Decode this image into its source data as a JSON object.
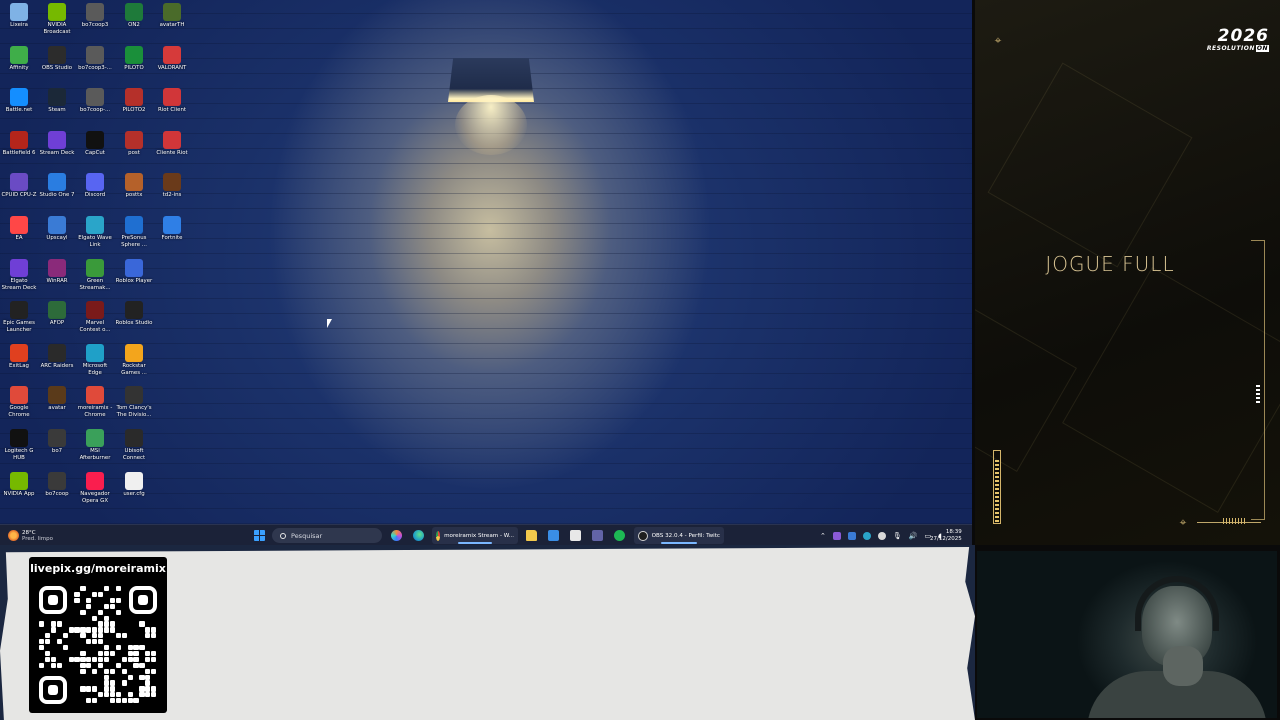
{
  "desktop": {
    "icons": [
      {
        "label": "Lixeira",
        "icon": "recycle-bin-icon",
        "color": "#7fb2e5"
      },
      {
        "label": "NVIDIA Broadcast",
        "icon": "nvidia-icon",
        "color": "#76b900"
      },
      {
        "label": "bo7coop3",
        "icon": "game-icon",
        "color": "#5a5a5a"
      },
      {
        "label": "ON2",
        "icon": "app-icon",
        "color": "#1e7a3a"
      },
      {
        "label": "avatarTH",
        "icon": "game-icon",
        "color": "#4a6b2a"
      },
      {
        "label": "Affinity",
        "icon": "affinity-icon",
        "color": "#3fae49"
      },
      {
        "label": "OBS Studio",
        "icon": "obs-icon",
        "color": "#2c2c2c"
      },
      {
        "label": "bo7coop3-...",
        "icon": "game-icon",
        "color": "#5a5a5a"
      },
      {
        "label": "PILOTO",
        "icon": "app-icon",
        "color": "#1a8f3a"
      },
      {
        "label": "VALORANT",
        "icon": "valorant-icon",
        "color": "#d63a3a"
      },
      {
        "label": "Battle.net",
        "icon": "battlenet-icon",
        "color": "#148eff"
      },
      {
        "label": "Steam",
        "icon": "steam-icon",
        "color": "#1b2838"
      },
      {
        "label": "bo7coop-...",
        "icon": "game-icon",
        "color": "#5a5a5a"
      },
      {
        "label": "PILOTO2",
        "icon": "app-icon",
        "color": "#b5302a"
      },
      {
        "label": "Riot Client",
        "icon": "riot-icon",
        "color": "#d13639"
      },
      {
        "label": "Battlefield 6",
        "icon": "game-icon",
        "color": "#b4251b"
      },
      {
        "label": "Stream Deck",
        "icon": "streamdeck-icon",
        "color": "#6f3fd6"
      },
      {
        "label": "CapCut",
        "icon": "capcut-icon",
        "color": "#111111"
      },
      {
        "label": "post",
        "icon": "app-icon",
        "color": "#b5302a"
      },
      {
        "label": "Cliente Riot",
        "icon": "riot-icon",
        "color": "#d13639"
      },
      {
        "label": "CPUID CPU-Z",
        "icon": "cpuz-icon",
        "color": "#6a4bc4"
      },
      {
        "label": "Studio One 7",
        "icon": "studio-one-icon",
        "color": "#2a7de1"
      },
      {
        "label": "Discord",
        "icon": "discord-icon",
        "color": "#5865f2"
      },
      {
        "label": "posttx",
        "icon": "app-icon",
        "color": "#b5612a"
      },
      {
        "label": "td2-ins",
        "icon": "game-icon",
        "color": "#6a3a1a"
      },
      {
        "label": "EA",
        "icon": "ea-icon",
        "color": "#ff4747"
      },
      {
        "label": "Upscayl",
        "icon": "upscayl-icon",
        "color": "#3a7bd5"
      },
      {
        "label": "Elgato Wave Link",
        "icon": "elgato-icon",
        "color": "#2aa5c9"
      },
      {
        "label": "PreSonus Sphere ...",
        "icon": "presonus-icon",
        "color": "#1f6fd1"
      },
      {
        "label": "Fortnite",
        "icon": "fortnite-icon",
        "color": "#2f7fe6"
      },
      {
        "label": "Elgato Stream Deck",
        "icon": "streamdeck-icon",
        "color": "#6f3fd6"
      },
      {
        "label": "WinRAR",
        "icon": "winrar-icon",
        "color": "#8a2a7a"
      },
      {
        "label": "Green Streamak...",
        "icon": "app-icon",
        "color": "#3a9a3a"
      },
      {
        "label": "Roblox Player",
        "icon": "roblox-icon",
        "color": "#3a67d9"
      },
      {
        "label": "Epic Games Launcher",
        "icon": "epic-icon",
        "color": "#222222"
      },
      {
        "label": "AFOP",
        "icon": "app-icon",
        "color": "#2d6b3a"
      },
      {
        "label": "Marvel Contest o...",
        "icon": "game-icon",
        "color": "#7a1a1a"
      },
      {
        "label": "Roblox Studio",
        "icon": "roblox-studio-icon",
        "color": "#222222"
      },
      {
        "label": "ExitLag",
        "icon": "exitlag-icon",
        "color": "#e0401f"
      },
      {
        "label": "ARC Raiders",
        "icon": "game-icon",
        "color": "#2a2a2a"
      },
      {
        "label": "Microsoft Edge",
        "icon": "edge-icon",
        "color": "#1fa0c8"
      },
      {
        "label": "Rockstar Games ...",
        "icon": "rockstar-icon",
        "color": "#f3a51c"
      },
      {
        "label": "Google Chrome",
        "icon": "chrome-icon",
        "color": "#e04a3a"
      },
      {
        "label": "avatar",
        "icon": "game-icon",
        "color": "#5a3a1a"
      },
      {
        "label": "moreiramix - Chrome",
        "icon": "chrome-icon",
        "color": "#e04a3a"
      },
      {
        "label": "Tom Clancy's The Divisio...",
        "icon": "ubisoft-icon",
        "color": "#333333"
      },
      {
        "label": "Logitech G HUB",
        "icon": "logitech-icon",
        "color": "#111111"
      },
      {
        "label": "bo7",
        "icon": "game-icon",
        "color": "#3a3a3a"
      },
      {
        "label": "MSI Afterburner",
        "icon": "msi-icon",
        "color": "#3aa05a"
      },
      {
        "label": "Ubisoft Connect",
        "icon": "ubisoft-icon",
        "color": "#2a2a2a"
      },
      {
        "label": "NVIDIA App",
        "icon": "nvidia-icon",
        "color": "#76b900"
      },
      {
        "label": "bo7coop",
        "icon": "game-icon",
        "color": "#3a3a3a"
      },
      {
        "label": "Navegador Opera GX",
        "icon": "opera-gx-icon",
        "color": "#fa1e4e"
      },
      {
        "label": "user.cfg",
        "icon": "file-icon",
        "color": "#f0f0f0"
      }
    ]
  },
  "taskbar": {
    "weather_temp": "28°C",
    "weather_desc": "Pred. limpo",
    "search_placeholder": "Pesquisar",
    "app_chrome_label": "moreiramix Stream - W...",
    "app_obs_label": "OBS 32.0.4 - Perfil: Twitc",
    "time": "18:39",
    "date": "27/12/2025",
    "colors": {
      "start": "#3aa0ff",
      "chrome": "#e04a3a",
      "explorer": "#f2c94c",
      "spotify": "#1db954",
      "edge": "#1fa0c8"
    }
  },
  "side_panel": {
    "logo_year": "2026",
    "logo_sub": "RESOLUTION",
    "logo_badge": "ON",
    "headline": "JOGUE FULL"
  },
  "banner": {
    "donation_url": "livepix.gg/moreiramix"
  }
}
